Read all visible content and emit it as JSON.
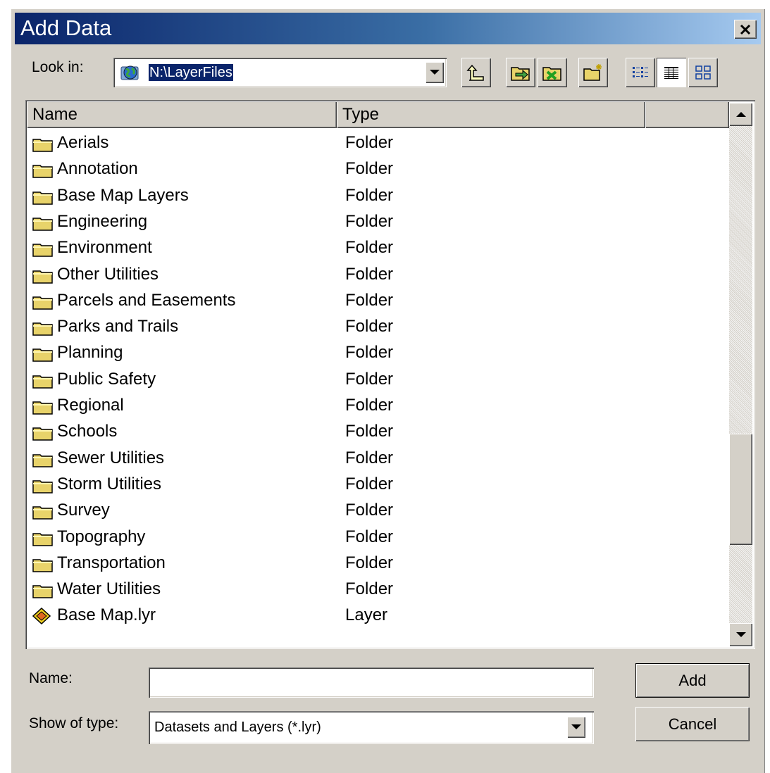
{
  "window": {
    "title": "Add Data"
  },
  "lookin": {
    "label": "Look in:",
    "value": "N:\\LayerFiles"
  },
  "toolbar": [
    {
      "name": "up-one-level",
      "icon": "up-folder-icon"
    },
    {
      "name": "connect-to-folder",
      "icon": "connect-folder-icon"
    },
    {
      "name": "disconnect-from-folder",
      "icon": "disconnect-folder-icon"
    },
    {
      "name": "new-folder",
      "icon": "new-folder-icon"
    },
    {
      "name": "list-view",
      "icon": "list-view-icon"
    },
    {
      "name": "details-view",
      "icon": "details-view-icon"
    },
    {
      "name": "thumbnails-view",
      "icon": "thumbnails-view-icon"
    }
  ],
  "list": {
    "columns": [
      "Name",
      "Type",
      ""
    ],
    "rows": [
      {
        "name": "Aerials",
        "type": "Folder",
        "icon": "folder-icon"
      },
      {
        "name": "Annotation",
        "type": "Folder",
        "icon": "folder-icon"
      },
      {
        "name": "Base Map Layers",
        "type": "Folder",
        "icon": "folder-icon"
      },
      {
        "name": "Engineering",
        "type": "Folder",
        "icon": "folder-icon"
      },
      {
        "name": "Environment",
        "type": "Folder",
        "icon": "folder-icon"
      },
      {
        "name": "Other Utilities",
        "type": "Folder",
        "icon": "folder-icon"
      },
      {
        "name": "Parcels and Easements",
        "type": "Folder",
        "icon": "folder-icon"
      },
      {
        "name": "Parks and Trails",
        "type": "Folder",
        "icon": "folder-icon"
      },
      {
        "name": "Planning",
        "type": "Folder",
        "icon": "folder-icon"
      },
      {
        "name": "Public Safety",
        "type": "Folder",
        "icon": "folder-icon"
      },
      {
        "name": "Regional",
        "type": "Folder",
        "icon": "folder-icon"
      },
      {
        "name": "Schools",
        "type": "Folder",
        "icon": "folder-icon"
      },
      {
        "name": "Sewer Utilities",
        "type": "Folder",
        "icon": "folder-icon"
      },
      {
        "name": "Storm Utilities",
        "type": "Folder",
        "icon": "folder-icon"
      },
      {
        "name": "Survey",
        "type": "Folder",
        "icon": "folder-icon"
      },
      {
        "name": "Topography",
        "type": "Folder",
        "icon": "folder-icon"
      },
      {
        "name": "Transportation",
        "type": "Folder",
        "icon": "folder-icon"
      },
      {
        "name": "Water Utilities",
        "type": "Folder",
        "icon": "folder-icon"
      },
      {
        "name": "Base Map.lyr",
        "type": "Layer",
        "icon": "layer-file-icon"
      }
    ]
  },
  "form": {
    "name_label": "Name:",
    "name_value": "",
    "type_label": "Show of type:",
    "type_value": "Datasets and Layers (*.lyr)"
  },
  "buttons": {
    "add": "Add",
    "cancel": "Cancel"
  },
  "colors": {
    "title_start": "#0a246a",
    "title_end": "#a6caf0",
    "face": "#d4d0c8",
    "selection": "#0a246a",
    "folder": "#e8d36a"
  }
}
